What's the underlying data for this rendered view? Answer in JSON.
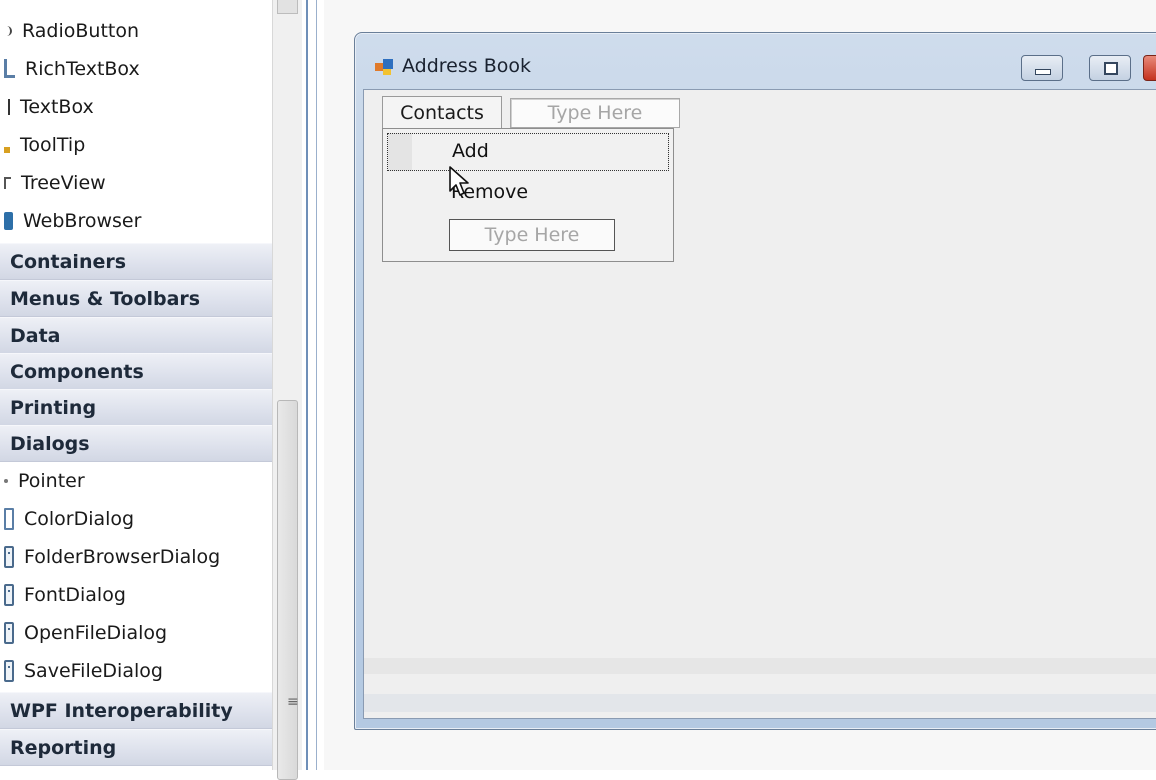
{
  "toolbox": {
    "items_top": [
      {
        "label": "RadioButton",
        "icon": "radiobutton-icon"
      },
      {
        "label": "RichTextBox",
        "icon": "richtextbox-icon"
      },
      {
        "label": "TextBox",
        "icon": "textbox-icon"
      },
      {
        "label": "ToolTip",
        "icon": "tooltip-icon"
      },
      {
        "label": "TreeView",
        "icon": "treeview-icon"
      },
      {
        "label": "WebBrowser",
        "icon": "webbrowser-icon"
      }
    ],
    "categories_top": [
      "Containers",
      "Menus & Toolbars",
      "Data",
      "Components",
      "Printing",
      "Dialogs"
    ],
    "dialogs_items": [
      {
        "label": "Pointer",
        "icon": "pointer-icon"
      },
      {
        "label": "ColorDialog",
        "icon": "colordialog-icon"
      },
      {
        "label": "FolderBrowserDialog",
        "icon": "folderbrowserdialog-icon"
      },
      {
        "label": "FontDialog",
        "icon": "fontdialog-icon"
      },
      {
        "label": "OpenFileDialog",
        "icon": "openfiledialog-icon"
      },
      {
        "label": "SaveFileDialog",
        "icon": "savefiledialog-icon"
      }
    ],
    "categories_bottom": [
      "WPF Interoperability",
      "Reporting"
    ],
    "scroll_grip": "≡"
  },
  "form": {
    "title": "Address Book",
    "icon": "form-app-icon",
    "menu": {
      "contacts_label": "Contacts",
      "type_here_label": "Type Here"
    },
    "dropdown": {
      "items": [
        "Add",
        "Remove"
      ],
      "type_here_label": "Type Here"
    }
  },
  "colors": {
    "titlebar": "#bcd0e6",
    "category_header": "#dde1ec",
    "close_button": "#c5321f",
    "splitter": "#6f8fb8"
  }
}
